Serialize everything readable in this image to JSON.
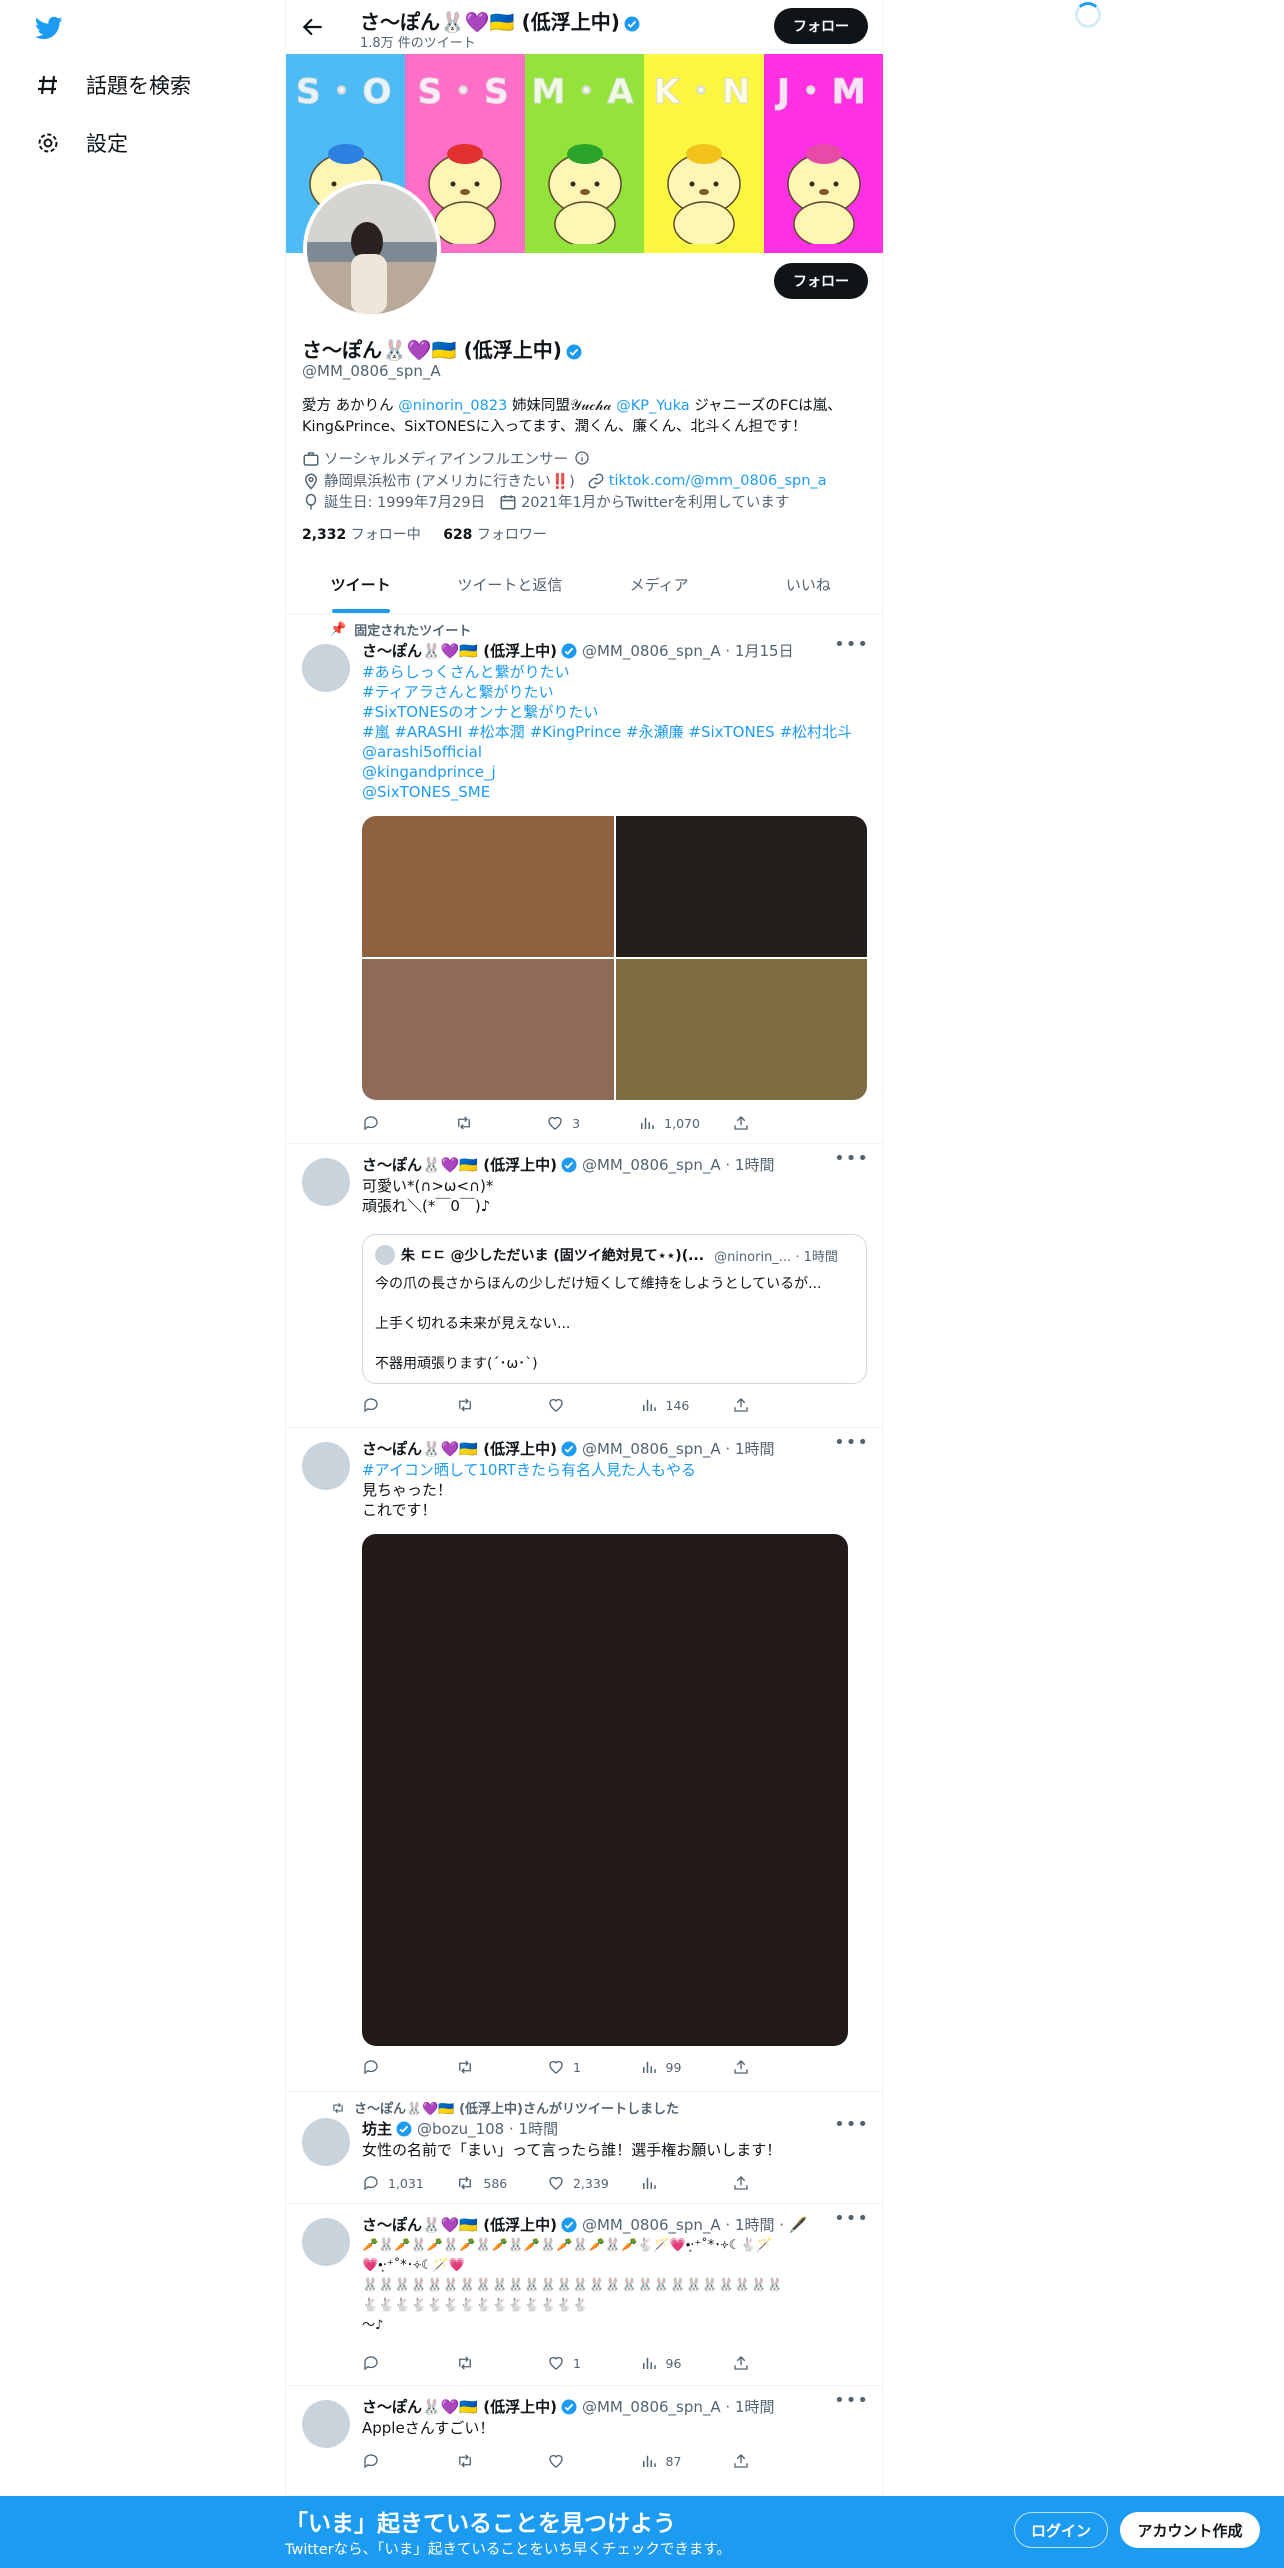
{
  "nav": {
    "explore_label": "話題を検索",
    "settings_label": "設定"
  },
  "header": {
    "name": "さ〜ぽん🐰💜🇺🇦 (低浮上中)",
    "tweet_count": "1.8万 件のツイート",
    "follow_label": "フォロー"
  },
  "banner": {
    "panels": [
      {
        "letters": "S・O",
        "color": "#4fbbf4"
      },
      {
        "letters": "S・S",
        "color": "#ff6ec7"
      },
      {
        "letters": "M・A",
        "color": "#93e33b"
      },
      {
        "letters": "K・N",
        "color": "#fbf63f"
      },
      {
        "letters": "J・M",
        "color": "#ff2fe4"
      }
    ],
    "hats": [
      "#2d7fe0",
      "#e0312e",
      "#2aa52a",
      "#f3c21a",
      "#e84aa8"
    ]
  },
  "profile": {
    "name": "さ〜ぽん🐰💜🇺🇦 (低浮上中)",
    "handle": "@MM_0806_spn_A",
    "follow_label": "フォロー",
    "bio_parts": {
      "p1": "愛方 あかりん ",
      "l1": "@ninorin_0823",
      "p2": " 姉妹同盟𝒴𝓊𝒸𝒽𝒶 ",
      "l2": "@KP_Yuka",
      "p3": " ジャニーズのFCは嵐、King&Prince、SixTONESに入ってます、潤くん、廉くん、北斗くん担です！"
    },
    "category": "ソーシャルメディアインフルエンサー",
    "location": "静岡県浜松市 (アメリカに行きたい‼️)",
    "website": "tiktok.com/@mm_0806_spn_a",
    "birthday": "誕生日: 1999年7月29日",
    "joined": "2021年1月からTwitterを利用しています",
    "following_count": "2,332",
    "following_label": " フォロー中",
    "followers_count": "628",
    "followers_label": " フォロワー"
  },
  "tabs": [
    "ツイート",
    "ツイートと返信",
    "メディア",
    "いいね"
  ],
  "tweets": {
    "t1": {
      "pinned_label": "固定されたツイート",
      "name": "さ〜ぽん🐰💜🇺🇦 (低浮上中)",
      "meta": "@MM_0806_spn_A · 1月15日",
      "lines": [
        "#あらしっくさんと繋がりたい",
        "#ティアラさんと繋がりたい",
        "#SixTONESのオンナと繋がりたい",
        "#嵐 #ARASHI #松本潤 #KingPrince #永瀬廉 #SixTONES #松村北斗",
        " @arashi5official",
        "@kingandprince_j",
        "@SixTONES_SME"
      ],
      "images": [
        "#8e6141",
        "#221f1d",
        "#8f6b57",
        "#7e6c42"
      ],
      "reply": "",
      "retweet": "",
      "like": "3",
      "views": "1,070"
    },
    "t2": {
      "name": "さ〜ぽん🐰💜🇺🇦 (低浮上中)",
      "meta": "@MM_0806_spn_A · 1時間",
      "text": "可愛い*(∩>ω<∩)*\n頑張れ＼(*￣0￣)♪",
      "quote": {
        "name": "朱 ㄷㄷ @少しただいま (固ツイ絶対見て⋆⋆)(...",
        "meta": "@ninorin_... · 1時間",
        "l1": "今の爪の長さからほんの少しだけ短くして維持をしようとしているが...",
        "l2": "上手く切れる未来が見えない...",
        "l3": "不器用頑張ります(´･ω･`)"
      },
      "reply": "",
      "retweet": "",
      "like": "",
      "views": "146"
    },
    "t3": {
      "name": "さ〜ぽん🐰💜🇺🇦 (低浮上中)",
      "meta": "@MM_0806_spn_A · 1時間",
      "hashtag": "#アイコン晒して10RTきたら有名人見た人もやる",
      "text": "見ちゃった！\nこれです！",
      "image_color": "#231b1a",
      "reply": "",
      "retweet": "",
      "like": "1",
      "views": "99"
    },
    "t4": {
      "social": "さ〜ぽん🐰💜🇺🇦 (低浮上中)さんがリツイートしました",
      "name": "坊主",
      "meta": "@bozu_108 · 1時間",
      "text": "女性の名前で「まい」って言ったら誰！選手権お願いします！",
      "reply": "1,031",
      "retweet": "586",
      "like": "2,339",
      "views": ""
    },
    "t5": {
      "name": "さ〜ぽん🐰💜🇺🇦 (低浮上中)",
      "meta": "@MM_0806_spn_A · 1時間 · 🖋️",
      "l1": "🥕🐰🥕🐰🥕🐰🥕🐰🥕🐰🥕🐰🥕🐰🥕🐰🥕🐇🪄💗•͙‧⁺˚*･༓☾🐇🪄",
      "l2": "💗•͙‧⁺˚*･༓☾🪄💗",
      "l3": "🐰🐰🐰🐰🐰🐰🐰🐰🐰🐰🐰🐰🐰🐰🐰🐰🐰🐰🐰🐰🐰🐰🐰🐰🐰🐰",
      "l4": "🐇🐇🐇🐇🐇🐇🐇🐇🐇🐇🐇🐇🐇🐇",
      "l5": "〜♪",
      "reply": "",
      "retweet": "",
      "like": "1",
      "views": "96"
    },
    "t6": {
      "name": "さ〜ぽん🐰💜🇺🇦 (低浮上中)",
      "meta": "@MM_0806_spn_A · 1時間",
      "text": "Appleさんすごい！",
      "reply": "",
      "retweet": "",
      "like": "",
      "views": "87"
    }
  },
  "bottom_bar": {
    "headline": "「いま」起きていることを見つけよう",
    "subline": "Twitterなら、「いま」起きていることをいち早くチェックできます。",
    "login_label": "ログイン",
    "signup_label": "アカウント作成"
  },
  "colors": {
    "accent": "#1d9bf0",
    "dark": "#0f1419",
    "muted": "#536471"
  }
}
